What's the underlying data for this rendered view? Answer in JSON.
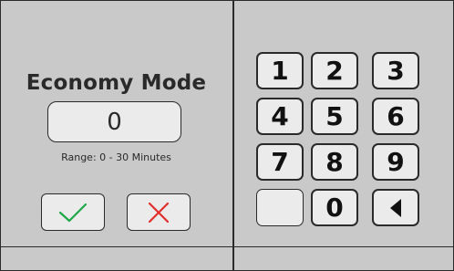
{
  "panel": {
    "title": "Economy Mode",
    "value": "0",
    "range": "Range: 0 - 30 Minutes"
  },
  "actions": {
    "confirm_icon": "check-icon",
    "cancel_icon": "x-icon",
    "confirm_color": "#1ea84a",
    "cancel_color": "#e0302c"
  },
  "keypad": {
    "keys": [
      "1",
      "2",
      "3",
      "4",
      "5",
      "6",
      "7",
      "8",
      "9",
      "",
      "0"
    ],
    "backspace_icon": "backspace-triangle-icon"
  }
}
